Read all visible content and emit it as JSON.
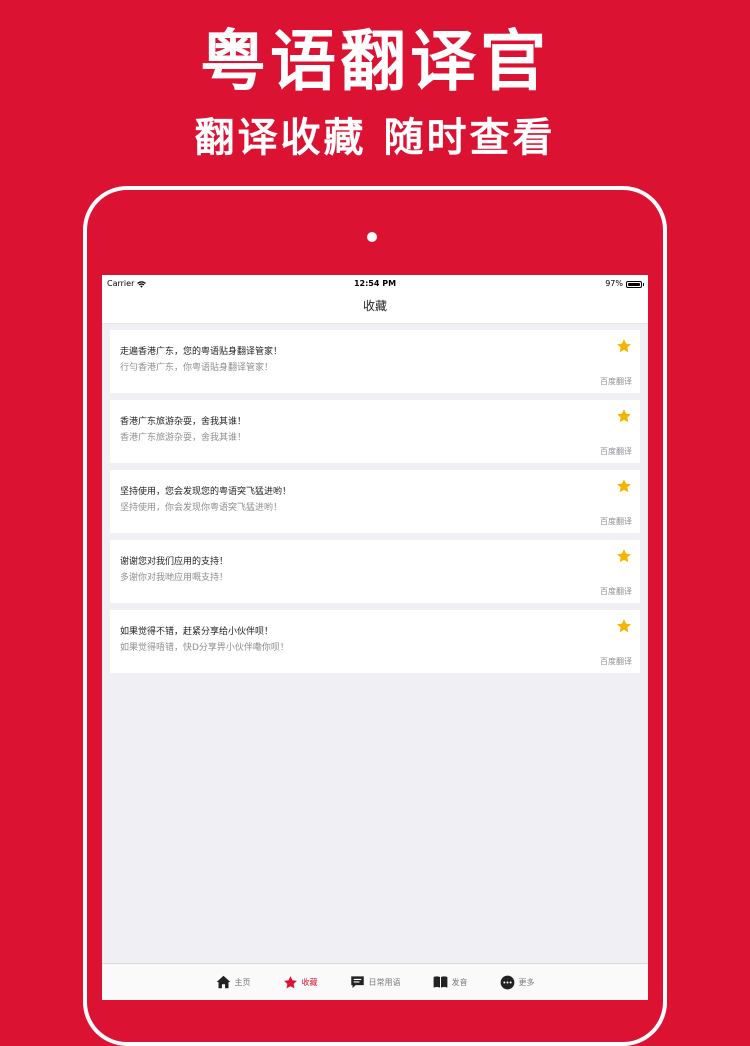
{
  "promo": {
    "title": "粤语翻译官",
    "subtitle": "翻译收藏  随时查看"
  },
  "status_bar": {
    "carrier": "Carrier",
    "time": "12:54 PM",
    "battery": "97%",
    "battery_level": 0.97
  },
  "nav": {
    "title": "收藏"
  },
  "favorites": [
    {
      "source": "走遍香港广东，您的粤语贴身翻译管家！",
      "result": "行勻香港广东，你粤语貼身翻译管家！",
      "engine": "百度翻译",
      "starred": true
    },
    {
      "source": "香港广东旅游杂耍，舍我其谁！",
      "result": "香港广东旅游杂耍，舍我其谁！",
      "engine": "百度翻译",
      "starred": true
    },
    {
      "source": "坚持使用，您会发现您的粤语突飞猛进哟！",
      "result": "坚持使用，你会发现你粤语突飞猛进哟！",
      "engine": "百度翻译",
      "starred": true
    },
    {
      "source": "谢谢您对我们应用的支持！",
      "result": "多谢你对我哋应用嘅支持！",
      "engine": "百度翻译",
      "starred": true
    },
    {
      "source": "如果觉得不错，赶紧分享给小伙伴呗！",
      "result": "如果觉得唔错，快D分享畀小伙伴嘞你呗！",
      "engine": "百度翻译",
      "starred": true
    }
  ],
  "tabs": [
    {
      "label": "主页",
      "icon": "home-icon",
      "active": false
    },
    {
      "label": "收藏",
      "icon": "star-icon",
      "active": true
    },
    {
      "label": "日常用语",
      "icon": "chat-icon",
      "active": false
    },
    {
      "label": "发音",
      "icon": "book-icon",
      "active": false
    },
    {
      "label": "更多",
      "icon": "more-icon",
      "active": false
    }
  ],
  "colors": {
    "brand_red": "#dc1232",
    "star_gold": "#f4b400",
    "screen_bg": "#efeff4"
  }
}
